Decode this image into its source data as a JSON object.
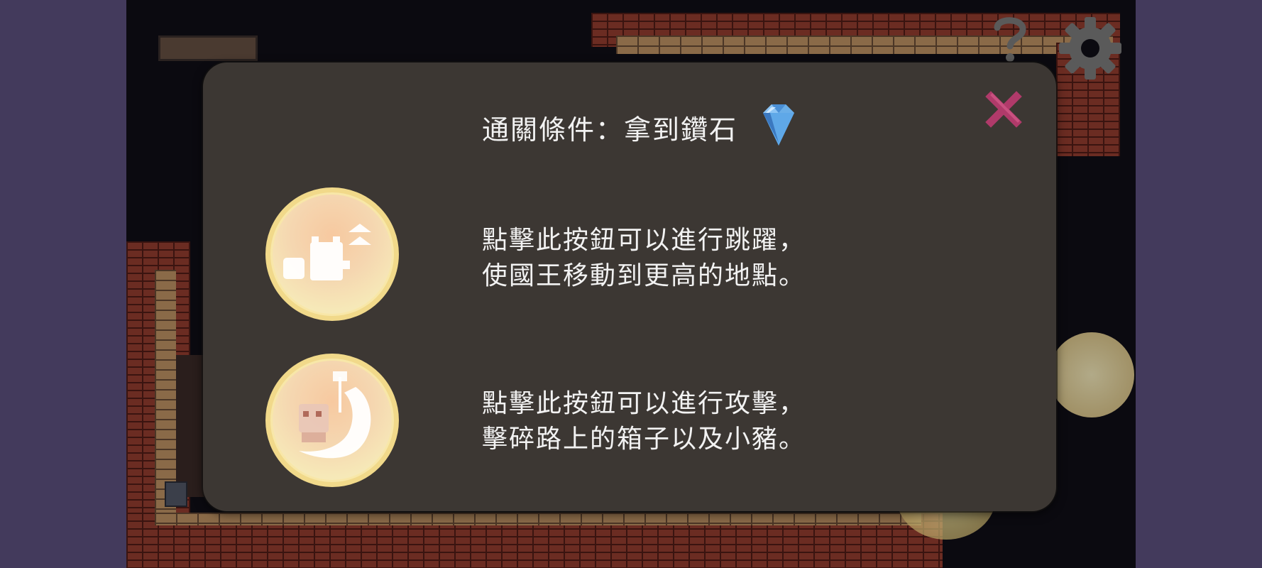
{
  "modal": {
    "condition_label": "通關條件：拿到鑽石",
    "items": [
      {
        "line1": "點擊此按鈕可以進行跳躍，",
        "line2": "使國王移動到更高的地點。"
      },
      {
        "line1": "點擊此按鈕可以進行攻擊，",
        "line2": "擊碎路上的箱子以及小豬。"
      }
    ]
  },
  "icons": {
    "help": "question-mark-icon",
    "settings": "gear-icon",
    "close": "close-x-icon",
    "diamond": "diamond-icon",
    "jump": "jump-arrow-icon",
    "attack": "hammer-slash-icon"
  },
  "colors": {
    "modal_bg": "#3c3733",
    "text": "#f2f2f2",
    "close": "#b03a6a",
    "bubble_ring": "#f1d98a",
    "diamond": "#5fa8e8"
  }
}
